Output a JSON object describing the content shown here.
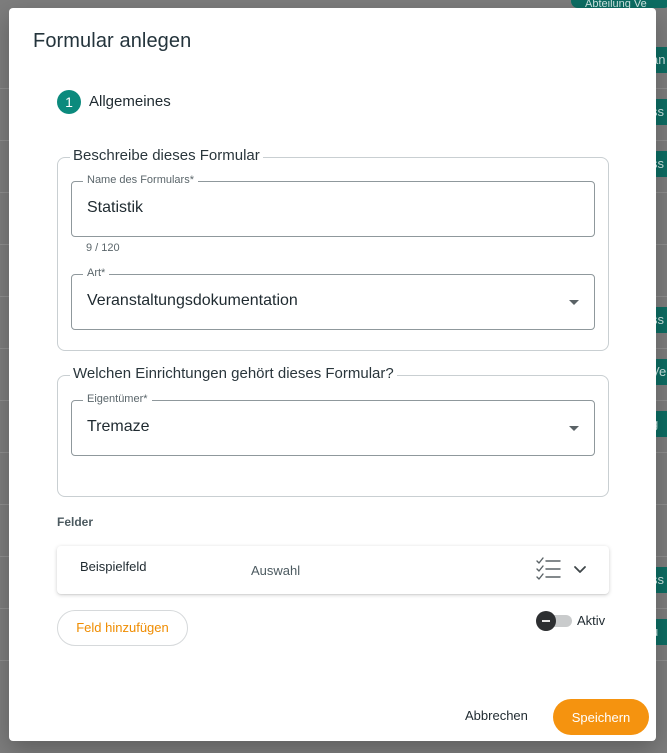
{
  "background": {
    "top_pill_text": "Abteilung Ve",
    "side_pills": [
      "an",
      "ss",
      "ss",
      "ss",
      "Ve",
      "g",
      "ss",
      "u"
    ]
  },
  "dialog": {
    "title": "Formular anlegen",
    "step": {
      "number": "1",
      "label": "Allgemeines"
    },
    "describe_section": {
      "legend": "Beschreibe dieses Formular",
      "name_field": {
        "label": "Name des Formulars*",
        "value": "Statistik",
        "counter": "9 / 120"
      },
      "type_field": {
        "label": "Art*",
        "value": "Veranstaltungsdokumentation"
      }
    },
    "owner_section": {
      "legend": "Welchen Einrichtungen gehört dieses Formular?",
      "owner_field": {
        "label": "Eigentümer*",
        "value": "Tremaze"
      }
    },
    "fields_section": {
      "heading": "Felder",
      "items": [
        {
          "name": "Beispielfeld",
          "type": "Auswahl",
          "icon": "checklist-icon"
        }
      ],
      "add_button": "Feld hinzufügen",
      "active_toggle": {
        "label": "Aktiv",
        "on": false
      }
    },
    "actions": {
      "cancel": "Abbrechen",
      "save": "Speichern"
    }
  },
  "colors": {
    "accent": "#0b8a7d",
    "primary_button": "#f5930f",
    "add_button_text": "#ef8c00"
  }
}
